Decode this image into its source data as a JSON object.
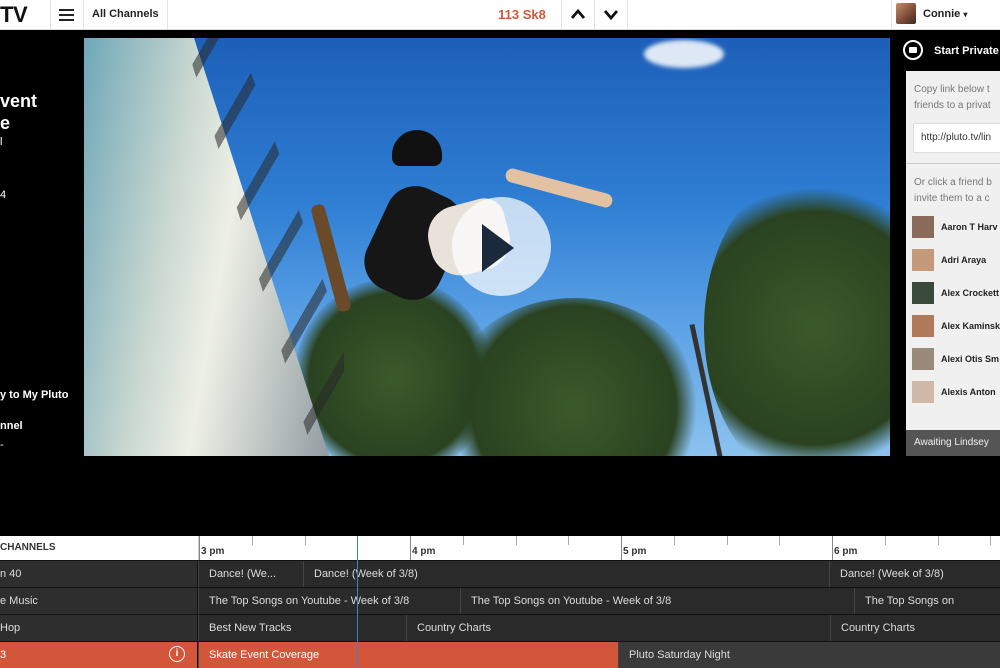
{
  "header": {
    "logo": "TV",
    "all_channels": "All Channels",
    "channel": "113 Sk8",
    "user_name": "Connie",
    "user_caret": "▾",
    "up_icon": "chevron-up-icon",
    "down_icon": "chevron-down-icon"
  },
  "info": {
    "title_line1": "vent",
    "title_line2": "e",
    "line3": "l",
    "line4": "4",
    "add_link": "y to My Pluto",
    "channel_link": "nnel",
    "dash": "-"
  },
  "private": {
    "title": "Start Private",
    "copy_line1": "Copy link below t",
    "copy_line2": "friends to a privat",
    "link": "http://pluto.tv/lin",
    "or_line1": "Or click a friend b",
    "or_line2": "invite them to a c",
    "friends": [
      "Aaron T Harv",
      "Adri Araya",
      "Alex Crockett",
      "Alex Kaminsk",
      "Alexi Otis Sm",
      "Alexis Anton"
    ],
    "friend_colors": [
      "#8a6a5a",
      "#c49a7a",
      "#3a4a3a",
      "#b07a5a",
      "#9a8a7a",
      "#d0b8a8"
    ],
    "footer": "Awaiting Lindsey"
  },
  "guide": {
    "header": "CHANNELS",
    "times": [
      "3 pm",
      "4 pm",
      "5 pm",
      "6 pm"
    ],
    "rows": [
      {
        "name": "n 40",
        "cells": [
          "Dance! (We...",
          "Dance! (Week of 3/8)",
          "Dance! (Week of 3/8)"
        ]
      },
      {
        "name": "e Music",
        "cells": [
          "The Top Songs on Youtube - Week of 3/8",
          "The Top Songs on Youtube - Week of 3/8",
          "The Top Songs on"
        ]
      },
      {
        "name": " Hop",
        "cells": [
          "Best New Tracks",
          "Country Charts",
          "Country Charts"
        ]
      },
      {
        "name": "3",
        "cells": [
          "Skate Event Coverage",
          "Pluto Saturday Night"
        ]
      }
    ]
  },
  "colors": {
    "accent": "#d4563a",
    "now_line": "#3d7fd0"
  }
}
